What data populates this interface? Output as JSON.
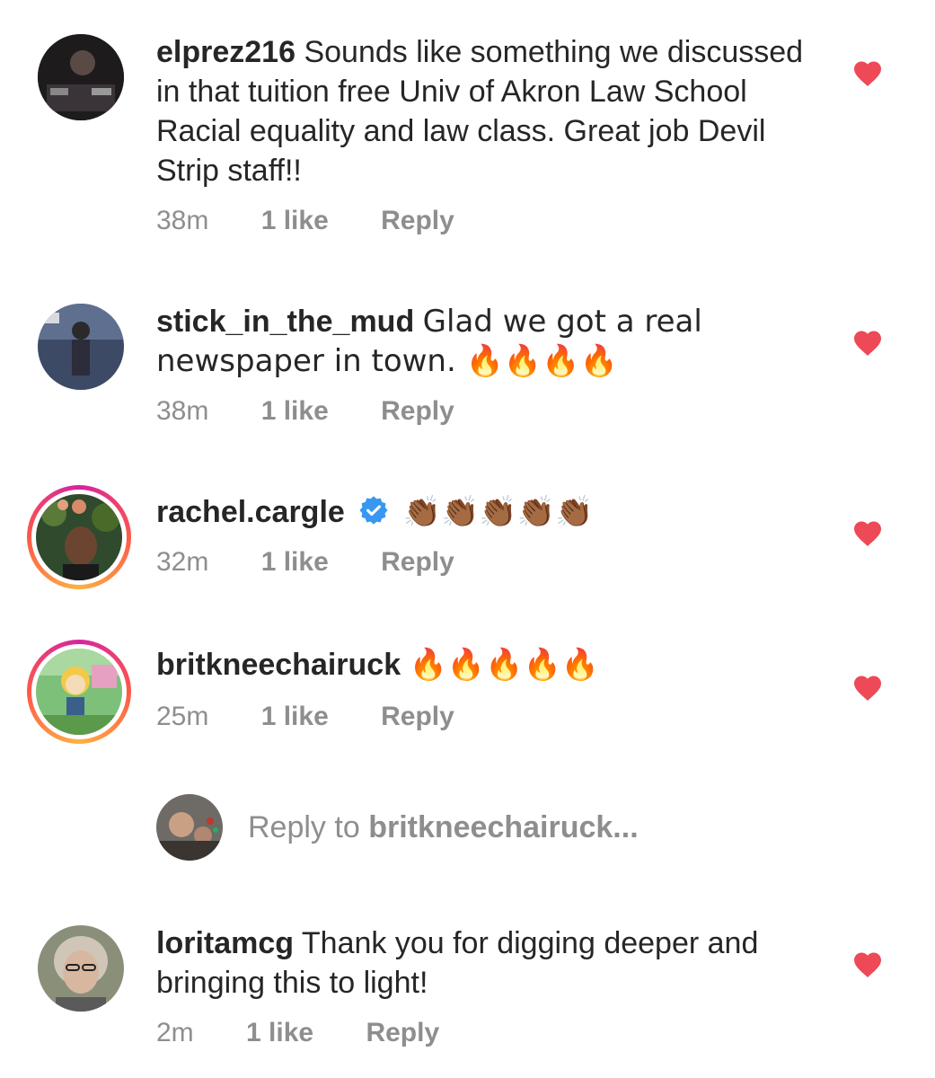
{
  "comments": [
    {
      "username": "elprez216",
      "text": "Sounds like something we discussed in that tuition free Univ of Akron Law School Racial equality and law class. Great job Devil Strip staff!!",
      "time": "38m",
      "likes": "1 like",
      "reply_label": "Reply"
    },
    {
      "username": "stick_in_the_mud",
      "text": "Glad we got a real newspaper in town. 🔥🔥🔥🔥",
      "time": "38m",
      "likes": "1 like",
      "reply_label": "Reply"
    },
    {
      "username": "rachel.cargle",
      "verified": true,
      "text": "👏🏾👏🏾👏🏾👏🏾👏🏾",
      "time": "32m",
      "likes": "1 like",
      "reply_label": "Reply"
    },
    {
      "username": "britkneechairuck",
      "text": "🔥🔥🔥🔥🔥",
      "time": "25m",
      "likes": "1 like",
      "reply_label": "Reply"
    },
    {
      "username": "loritamcg",
      "text": "Thank you for digging deeper and bringing this to light!",
      "time": "2m",
      "likes": "1 like",
      "reply_label": "Reply"
    }
  ],
  "reply_prompt": {
    "prefix": "Reply to ",
    "target": "britkneechairuck..."
  },
  "icons": {
    "like": "heart-icon",
    "verified": "verified-badge-icon"
  },
  "colors": {
    "heart": "#ed4956",
    "verified": "#3897f0",
    "muted_text": "#8e8e8e",
    "primary_text": "#262626"
  }
}
